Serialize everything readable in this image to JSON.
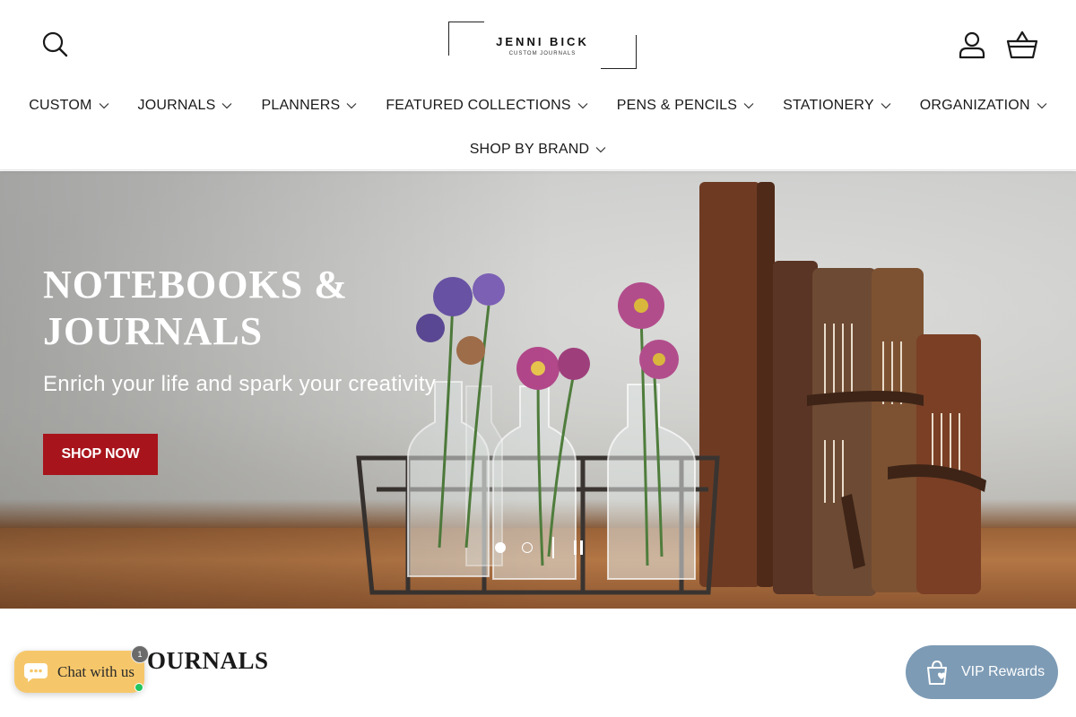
{
  "header": {
    "logo": {
      "name": "JENNI BICK",
      "tagline": "CUSTOM JOURNALS"
    },
    "icons": {
      "search": "search-icon",
      "account": "user-icon",
      "cart": "basket-icon"
    }
  },
  "nav": {
    "row1": [
      {
        "label": "CUSTOM"
      },
      {
        "label": "JOURNALS"
      },
      {
        "label": "PLANNERS"
      },
      {
        "label": "FEATURED COLLECTIONS"
      },
      {
        "label": "PENS & PENCILS"
      },
      {
        "label": "STATIONERY"
      },
      {
        "label": "ORGANIZATION"
      }
    ],
    "row2": [
      {
        "label": "SHOP BY BRAND"
      }
    ]
  },
  "hero": {
    "title": "NOTEBOOKS & JOURNALS",
    "subtitle": "Enrich your life and spark your creativity",
    "cta_label": "SHOP NOW",
    "slides_total": 2,
    "active_slide": 1
  },
  "section": {
    "title": "JOURNALS"
  },
  "chat": {
    "label": "Chat with us",
    "badge_count": "1"
  },
  "rewards": {
    "label": "VIP Rewards"
  },
  "colors": {
    "cta_red": "#a8141b",
    "chat_yellow": "#f6c76a",
    "vip_blue": "#7d9bb5",
    "online_green": "#22c55e"
  }
}
